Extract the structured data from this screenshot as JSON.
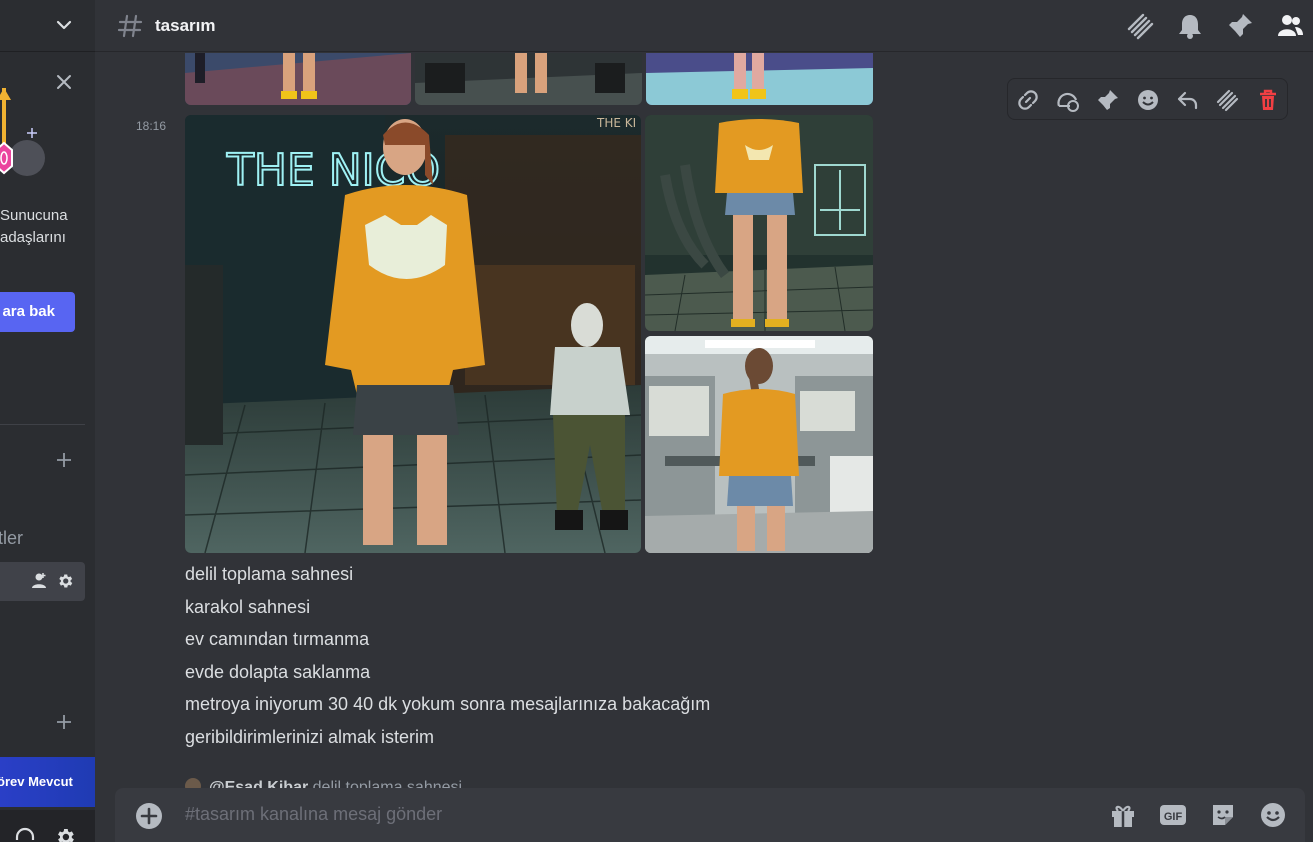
{
  "sidebar": {
    "promo_text": "Sunucuna\nadaşlarını",
    "promo_button": "ara bak",
    "category_label": "tler",
    "quest_label": "örev Mevcut"
  },
  "header": {
    "channel_name": "tasarım"
  },
  "message": {
    "time": "18:16",
    "image_texts": {
      "neon_sign": "THE NICO",
      "corner_sign": "THE KI"
    },
    "lines": [
      "delil toplama sahnesi",
      "karakol sahnesi",
      "ev camından tırmanma",
      "evde dolapta saklanma",
      "metroya iniyorum 30 40 dk yokum sonra mesajlarınıza bakacağım",
      "geribildirimlerinizi almak isterim"
    ]
  },
  "reply_preview": {
    "mention": "@Esad Kibar",
    "text": "delil toplama sahnesi"
  },
  "composer": {
    "placeholder": "#tasarım kanalına mesaj gönder",
    "gif_label": "GIF"
  },
  "colors": {
    "background": "#313338",
    "sidebar": "#2b2d31",
    "accent": "#5865f2",
    "danger": "#f23f43",
    "hoodie": "#e39a22"
  }
}
